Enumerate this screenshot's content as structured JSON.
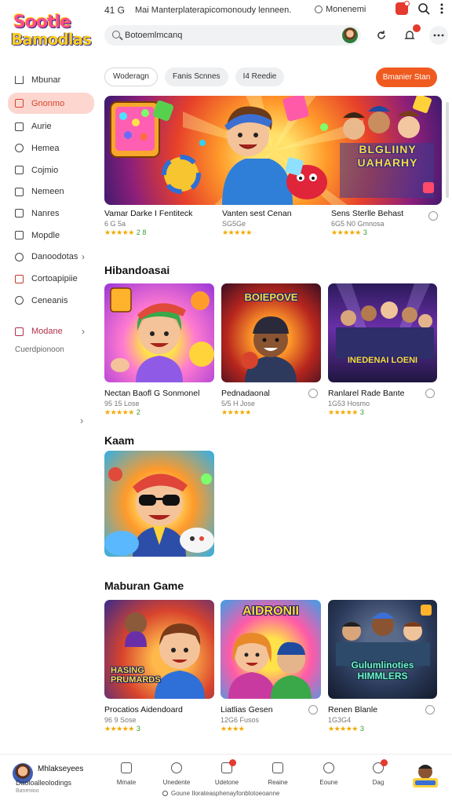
{
  "status": {
    "left": "41 G",
    "title": "Mai Manterplaterapicomonoudy lenneen.",
    "right": "Monenemi"
  },
  "logo": {
    "line1": "Sootle",
    "line2": "Bamodlas"
  },
  "search": {
    "value": "Botoemlmcanq"
  },
  "sidebar": {
    "items": [
      {
        "label": "Mbunar",
        "icon": "home-icon"
      },
      {
        "label": "Gnonmo",
        "icon": "games-icon"
      },
      {
        "label": "Aurie",
        "icon": "bookmark-icon"
      },
      {
        "label": "Hemea",
        "icon": "chat-icon"
      },
      {
        "label": "Cojmio",
        "icon": "document-icon"
      },
      {
        "label": "Nemeen",
        "icon": "camera-icon"
      },
      {
        "label": "Nanres",
        "icon": "mail-icon"
      },
      {
        "label": "Mopdle",
        "icon": "calendar-icon"
      },
      {
        "label": "Danoodotas",
        "icon": "clock-icon"
      },
      {
        "label": "Cortoapipiie",
        "icon": "bag-icon"
      },
      {
        "label": "Ceneanis",
        "icon": "time-icon"
      },
      {
        "label": "Modane",
        "icon": "heart-icon"
      }
    ],
    "footer_label": "Cuerdpionoon"
  },
  "filters": {
    "chips": [
      "Woderagn",
      "Fanis Scnnes",
      "I4 Reedie"
    ],
    "cta": "Bmanier Stan"
  },
  "banner": {
    "text": "BLGLIINY UAHARHY"
  },
  "top_games": [
    {
      "title": "Vamar Darke I Fentiteck",
      "meta": "6 G 5a",
      "rating": "★★★★★",
      "rating_num": "2 8"
    },
    {
      "title": "Vanten sest Cenan",
      "meta": "SG5Ge",
      "rating": "★★★★★",
      "rating_num": ""
    },
    {
      "title": "Sens Sterlle Behast",
      "meta": "6G5 N0 Gmnosa",
      "rating": "★★★★★",
      "rating_num": "3"
    }
  ],
  "section1": {
    "title": "Hibandoasai",
    "games": [
      {
        "title": "Nectan Baofl G Sonmonel",
        "meta": "95 15 Lose",
        "rating": "★★★★★",
        "rating_num": "2",
        "label": ""
      },
      {
        "title": "Pednadaonal",
        "meta": "5/5 H Jose",
        "rating": "★★★★★",
        "rating_num": "",
        "label": "BOIEPOVE"
      },
      {
        "title": "Ranlarel Rade Bante",
        "meta": "1G53 Hosmo",
        "rating": "★★★★★",
        "rating_num": "3",
        "label": "INEDENAI LOENI"
      }
    ]
  },
  "section2": {
    "title": "Kaam"
  },
  "section3": {
    "title": "Maburan Game",
    "games": [
      {
        "title": "Procatios Aidendoard",
        "meta": "96 9 Sose",
        "rating": "★★★★★",
        "rating_num": "3",
        "label": "HASING PRUMARDS"
      },
      {
        "title": "Liatlias Gesen",
        "meta": "12G6 Fusos",
        "rating": "★★★★",
        "rating_num": "",
        "label": "AIDRONII"
      },
      {
        "title": "Renen Blanle",
        "meta": "1G3G4",
        "rating": "★★★★★",
        "rating_num": "3",
        "label": "Gulumlinoties HIMMLERS"
      }
    ]
  },
  "bottombar": {
    "user_name": "Mhlakseyees",
    "user_sub": "Daoloalleolodings",
    "user_sub2": "Banenioo",
    "nav": [
      {
        "label": "Mmate",
        "icon": "home-icon"
      },
      {
        "label": "Unedente",
        "icon": "people-icon"
      },
      {
        "label": "Udetone",
        "icon": "inbox-icon"
      },
      {
        "label": "Reaine",
        "icon": "download-icon"
      },
      {
        "label": "Eoune",
        "icon": "search-icon"
      },
      {
        "label": "Dag",
        "icon": "chat-icon"
      }
    ],
    "footer": "Goune Ilorateasphenayfonblotoeoanne"
  },
  "colors": {
    "accent": "#ef5a1f",
    "active_bg": "#fcd6cf",
    "active_text": "#d8432d",
    "star": "#f2a900"
  }
}
